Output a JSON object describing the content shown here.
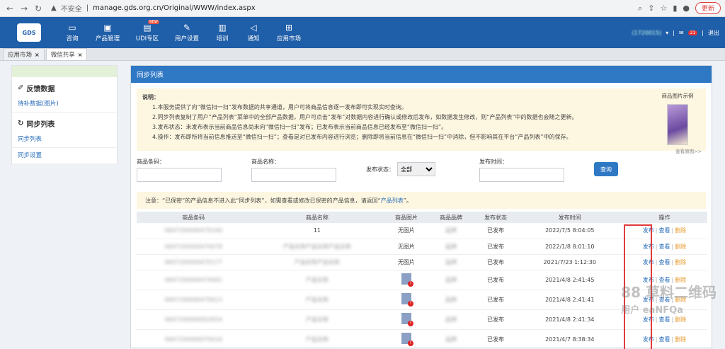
{
  "browser": {
    "insecure_label": "不安全",
    "url": "manage.gds.org.cn/Original/WWW/index.aspx",
    "update_label": "更新"
  },
  "appbar": {
    "logo_text": "GDS",
    "menu": [
      {
        "label": "咨询",
        "icon": "chat-icon"
      },
      {
        "label": "产品管理",
        "icon": "box-icon"
      },
      {
        "label": "UDI专区",
        "icon": "id-card-icon",
        "badge": "NEW"
      },
      {
        "label": "用户设置",
        "icon": "edit-icon"
      },
      {
        "label": "培训",
        "icon": "book-icon"
      },
      {
        "label": "通知",
        "icon": "speaker-icon"
      },
      {
        "label": "应用市场",
        "icon": "grid-icon"
      }
    ],
    "user": "(1720015)",
    "msg_count": "21",
    "logout": "退出"
  },
  "tabs": [
    {
      "label": "应用市场"
    },
    {
      "label": "微信共享"
    }
  ],
  "sidebar": {
    "section1": "反馈数据",
    "link1": "待补数据(图片)",
    "section2": "同步列表",
    "link2": "同步列表",
    "link3": "同步设置"
  },
  "panel": {
    "title": "同步列表",
    "notice_heading": "说明：",
    "notice_lines": [
      "1.本服务提供了向“微信扫一扫”发布数据的共享通道，用户可将商品信息逐一发布即可实现实时查询。",
      "2.同步列表复制了用户“产品列表”菜单中的全部产品数据，用户可点击“发布”对数据内容进行确认或修改后发布，如数据发生修改，则“产品列表”中的数据也会随之更新。",
      "3.发布状态：未发布表示当前商品信息尚未向“微信扫一扫”发布；已发布表示当前商品信息已经发布至“微信扫一扫”。",
      "4.操作：发布即所将当前信息推送至“微信扫一扫”；查看是对已发布内容进行浏览；删除即将当前信息在“微信扫一扫”中消除，但不影响其在平台“产品列表”中的保存。"
    ],
    "sample_label": "商品图片示例",
    "sample_more": "查看原图>>",
    "filters": {
      "barcode_label": "商品条码：",
      "name_label": "商品名称：",
      "status_label": "发布状态：",
      "status_value": "全部",
      "time_label": "发布时间：",
      "search_label": "查询"
    },
    "warn_text": "注意：“已保密”的产品信息不进入此“同步列表”，如需查看或修改已保密的产品信息，请返回“",
    "warn_link": "产品列表",
    "warn_tail": "”。",
    "columns": [
      "商品条码",
      "商品名称",
      "商品图片",
      "商品品牌",
      "发布状态",
      "发布时间",
      "操作"
    ],
    "rows": [
      {
        "barcode": "0697200000470160",
        "name": "11",
        "image": "无图片",
        "brand": "品牌",
        "status": "已发布",
        "time": "2022/7/5 8:04:05"
      },
      {
        "barcode": "0697200000470078",
        "name": "产品名称产品名称产品名称",
        "image": "无图片",
        "brand": "品牌",
        "status": "已发布",
        "time": "2022/1/8 8:01:10"
      },
      {
        "barcode": "0697200000470177",
        "name": "产品名称产品名称",
        "image": "无图片",
        "brand": "品牌",
        "status": "已发布",
        "time": "2021/7/23 1:12:30"
      },
      {
        "barcode": "0697200000470061",
        "name": "产品名称",
        "image": "",
        "brand": "品牌",
        "status": "已发布",
        "time": "2021/4/8 2:41:45"
      },
      {
        "barcode": "0697200000470023",
        "name": "产品名称",
        "image": "",
        "brand": "品牌",
        "status": "已发布",
        "time": "2021/4/8 2:41:41"
      },
      {
        "barcode": "0697200000003054",
        "name": "产品名称",
        "image": "",
        "brand": "品牌",
        "status": "已发布",
        "time": "2021/4/8 2:41:34"
      },
      {
        "barcode": "0697200000070016",
        "name": "产品名称",
        "image": "",
        "brand": "品牌",
        "status": "已发布",
        "time": "2021/4/7 8:38:34"
      }
    ],
    "actions": {
      "publish": "发布",
      "view": "查看",
      "delete": "删除"
    }
  },
  "watermark": {
    "line1": "88 草料二维码",
    "line2": "用户 eaNFQa"
  }
}
